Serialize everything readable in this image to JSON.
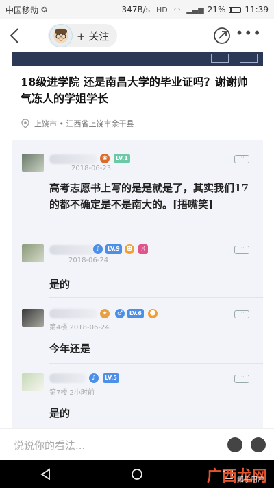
{
  "status_bar": {
    "carrier": "中国移动",
    "speed": "347B/s",
    "signal": "4G",
    "battery": "21%",
    "battery_level": 0.21,
    "time": "11:39"
  },
  "header": {
    "follow_label": "+ 关注",
    "back_icon": "chevron-left-icon",
    "share_icon": "share-icon",
    "more_icon": "more-icon"
  },
  "post": {
    "question": "18级进学院 还是南昌大学的毕业证吗？谢谢帅气冻人的学姐学长",
    "location": "上饶市 • 江西省上饶市余干县"
  },
  "replies": [
    {
      "meta": "2018-06-23",
      "level": "LV.1",
      "text": "高考志愿书上写的是是就是了，其实我们17的都不确定是不是南大的。[捂嘴笑]"
    },
    {
      "meta": "2018-06-24",
      "level": "LV.9",
      "text": "是的"
    },
    {
      "meta": "第4楼 2018-06-24",
      "level": "LV.6",
      "text": "今年还是"
    },
    {
      "meta": "第7楼 2小时前",
      "level": "LV.5",
      "text": "是的"
    }
  ],
  "comment_bar": {
    "placeholder": "说说你的看法..."
  },
  "watermark": {
    "brand": "广西龙网",
    "sub": "知乎用户"
  },
  "colors": {
    "accent_blue": "#4c8fe8",
    "level_green": "#6cc9a6",
    "photo_strip": "#2b3856"
  }
}
